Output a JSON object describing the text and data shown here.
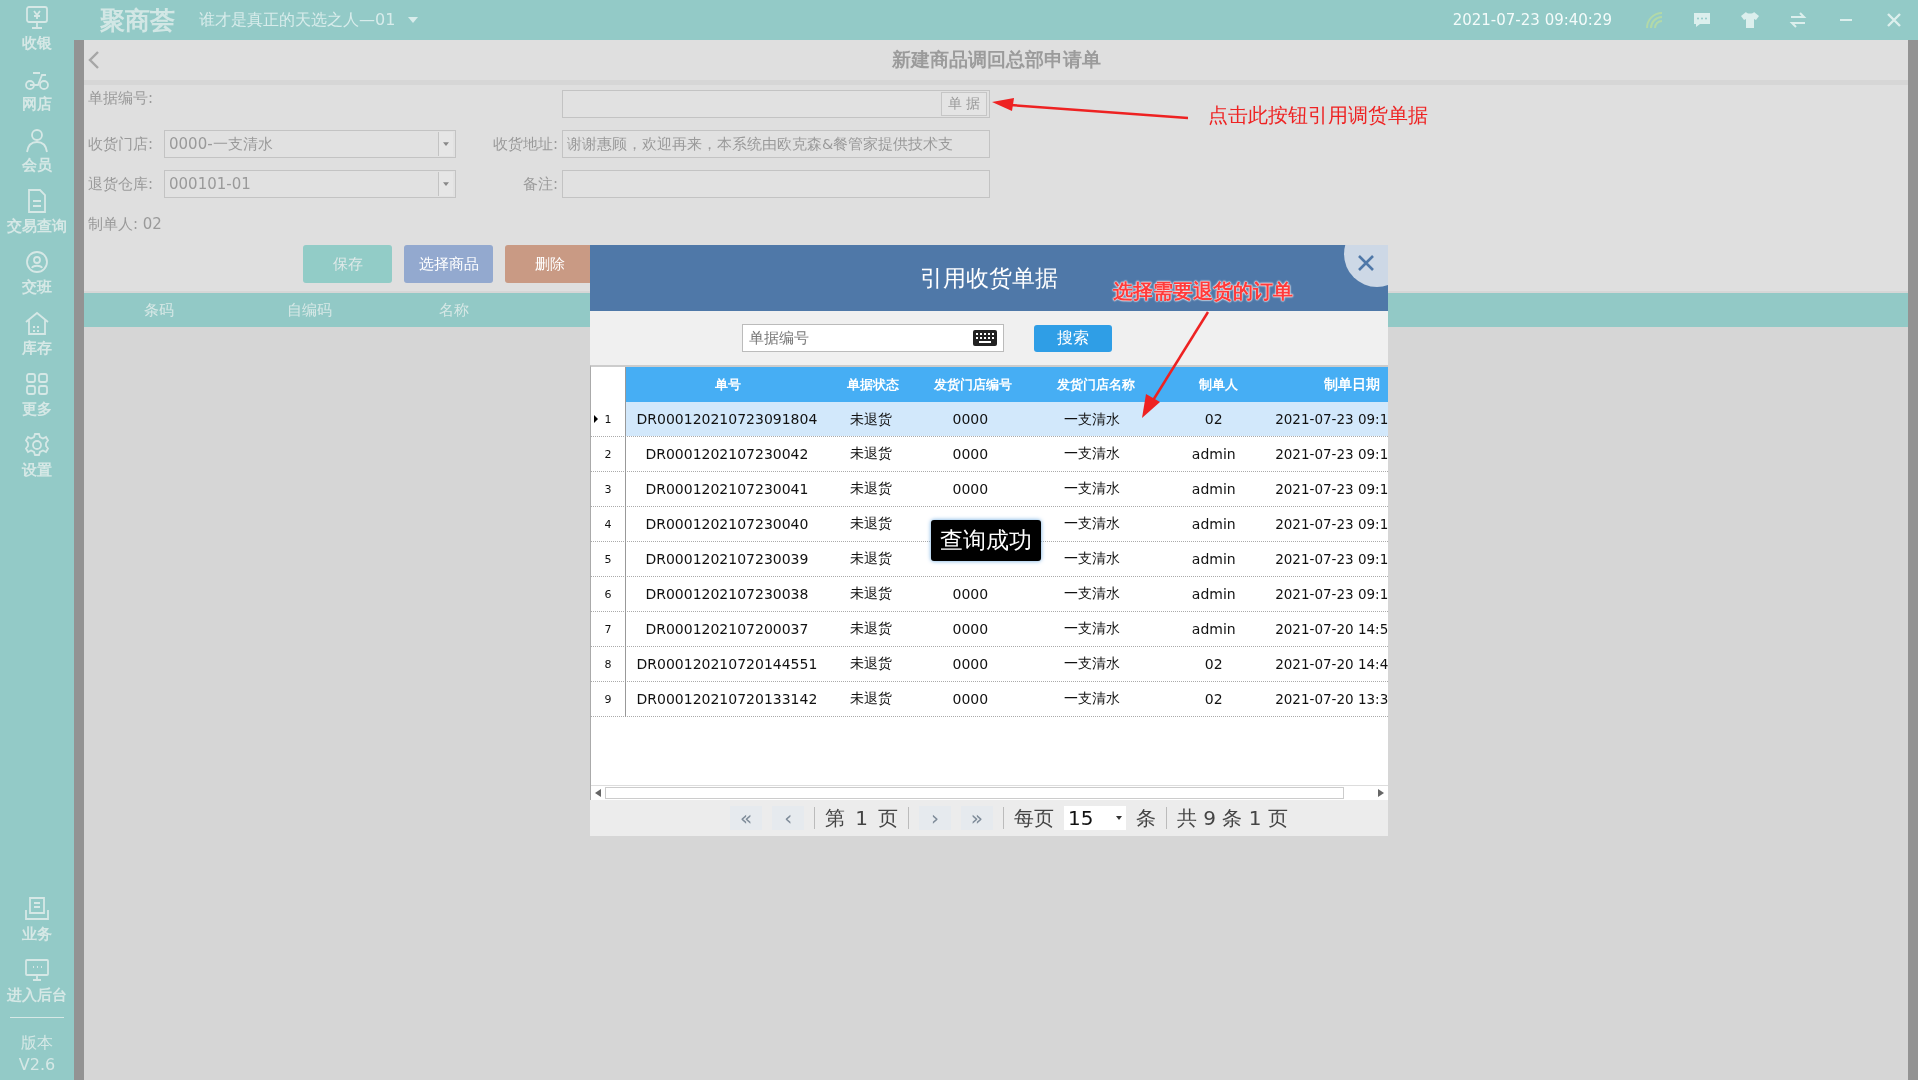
{
  "sidebar": {
    "items": [
      {
        "label": "收银"
      },
      {
        "label": "网店"
      },
      {
        "label": "会员"
      },
      {
        "label": "交易查询"
      },
      {
        "label": "交班"
      },
      {
        "label": "库存"
      },
      {
        "label": "更多"
      },
      {
        "label": "设置"
      }
    ],
    "bottom_items": [
      {
        "label": "业务"
      },
      {
        "label": "进入后台"
      }
    ],
    "version_label": "版本",
    "version": "V2.6"
  },
  "top_bar": {
    "logo": "聚商荟",
    "store": "谁才是真正的天选之人—01",
    "datetime": "2021-07-23 09:40:29"
  },
  "page_title": "新建商品调回总部申请单",
  "form": {
    "doc_no_label": "单据编号:",
    "doc_button": "单 据",
    "store_label": "收货门店:",
    "store_value": "0000-一支清水",
    "address_label": "收货地址:",
    "address_value": "谢谢惠顾，欢迎再来，本系统由欧克森&餐管家提供技术支",
    "warehouse_label": "退货仓库:",
    "warehouse_value": "000101-01",
    "remark_label": "备注:",
    "maker_label": "制单人: 02"
  },
  "buttons": [
    {
      "label": "保存",
      "kind": "save"
    },
    {
      "label": "选择商品",
      "kind": "select"
    },
    {
      "label": "删除",
      "kind": "delete"
    }
  ],
  "grid_columns": [
    "条码",
    "自编码",
    "名称"
  ],
  "dialog": {
    "title": "引用收货单据",
    "search": {
      "placeholder": "单据编号"
    },
    "search_button": "搜索",
    "columns": [
      "单号",
      "单据状态",
      "发货门店编号",
      "发货门店名称",
      "制单人",
      "制单日期"
    ],
    "rows": [
      {
        "index": "1",
        "no": "DR000120210723091804",
        "status": "未退货",
        "store_code": "0000",
        "store_name": "一支清水",
        "maker": "02",
        "date": "2021-07-23 09:1",
        "selected": true
      },
      {
        "index": "2",
        "no": "DR0001202107230042",
        "status": "未退货",
        "store_code": "0000",
        "store_name": "一支清水",
        "maker": "admin",
        "date": "2021-07-23 09:1",
        "selected": false
      },
      {
        "index": "3",
        "no": "DR0001202107230041",
        "status": "未退货",
        "store_code": "0000",
        "store_name": "一支清水",
        "maker": "admin",
        "date": "2021-07-23 09:1",
        "selected": false
      },
      {
        "index": "4",
        "no": "DR0001202107230040",
        "status": "未退货",
        "store_name": "一支清水",
        "maker": "admin",
        "date": "2021-07-23 09:1",
        "selected": false
      },
      {
        "index": "5",
        "no": "DR0001202107230039",
        "status": "未退货",
        "store_name": "一支清水",
        "maker": "admin",
        "date": "2021-07-23 09:1",
        "selected": false
      },
      {
        "index": "6",
        "no": "DR0001202107230038",
        "status": "未退货",
        "store_code": "0000",
        "store_name": "一支清水",
        "maker": "admin",
        "date": "2021-07-23 09:1",
        "selected": false
      },
      {
        "index": "7",
        "no": "DR0001202107200037",
        "status": "未退货",
        "store_code": "0000",
        "store_name": "一支清水",
        "maker": "admin",
        "date": "2021-07-20 14:5",
        "selected": false
      },
      {
        "index": "8",
        "no": "DR000120210720144551",
        "status": "未退货",
        "store_code": "0000",
        "store_name": "一支清水",
        "maker": "02",
        "date": "2021-07-20 14:4",
        "selected": false
      },
      {
        "index": "9",
        "no": "DR000120210720133142",
        "status": "未退货",
        "store_code": "0000",
        "store_name": "一支清水",
        "maker": "02",
        "date": "2021-07-20 13:3",
        "selected": false
      }
    ],
    "toast": "查询成功",
    "pager": {
      "first": "«",
      "prev": "‹",
      "page_prefix": "第",
      "page": "1",
      "page_suffix": "页",
      "next": "›",
      "last": "»",
      "per_page_label": "每页",
      "per_page": "15",
      "per_page_unit": "条",
      "total": "共 9 条 1 页"
    }
  },
  "annotations": [
    {
      "text": "点击此按钮引用调货单据"
    },
    {
      "text": "选择需要退货的订单"
    }
  ]
}
